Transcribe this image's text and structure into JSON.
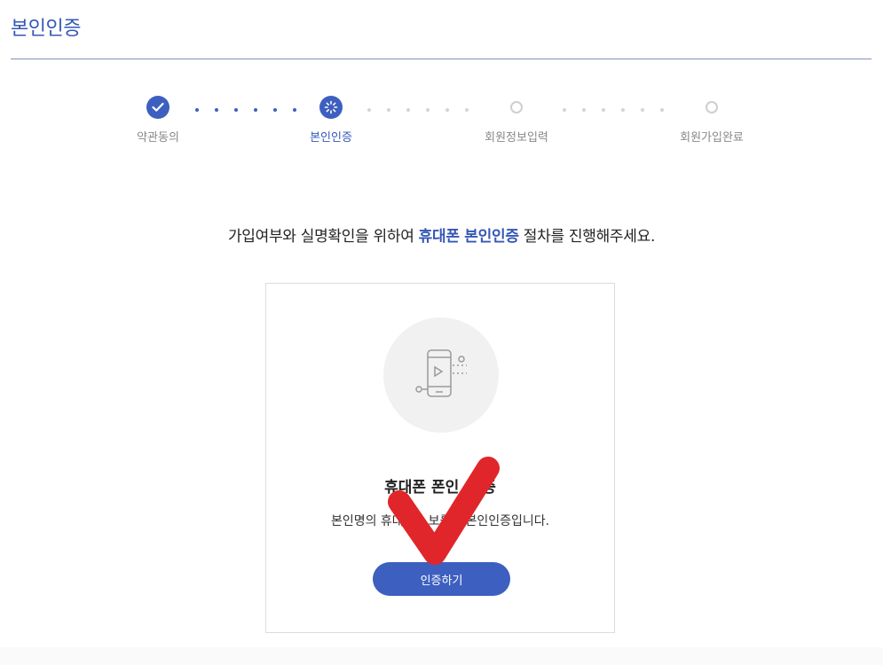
{
  "header": {
    "title": "본인인증"
  },
  "steps": [
    {
      "label": "약관동의",
      "state": "done"
    },
    {
      "label": "본인인증",
      "state": "current"
    },
    {
      "label": "회원정보입력",
      "state": "pending"
    },
    {
      "label": "회원가입완료",
      "state": "pending"
    }
  ],
  "instruction": {
    "before": "가입여부와 실명확인을 위하여 ",
    "highlight": "휴대폰 본인인증",
    "after": " 절차를 진행해주세요."
  },
  "card": {
    "title": "휴대폰 폰인",
    "title_tail": "증",
    "desc_start": "본인명의 휴대",
    "desc_mid": "보를",
    "desc_end": "본인인증입니다.",
    "button_label": "인증하기"
  },
  "colors": {
    "accent": "#3d5fc0",
    "title_blue": "#3557b7",
    "check_red": "#e0262a",
    "pending_gray": "#cfcfcf"
  },
  "icons": {
    "done": "check-icon",
    "current": "loading-spinner-icon",
    "card": "phone-verification-icon"
  }
}
